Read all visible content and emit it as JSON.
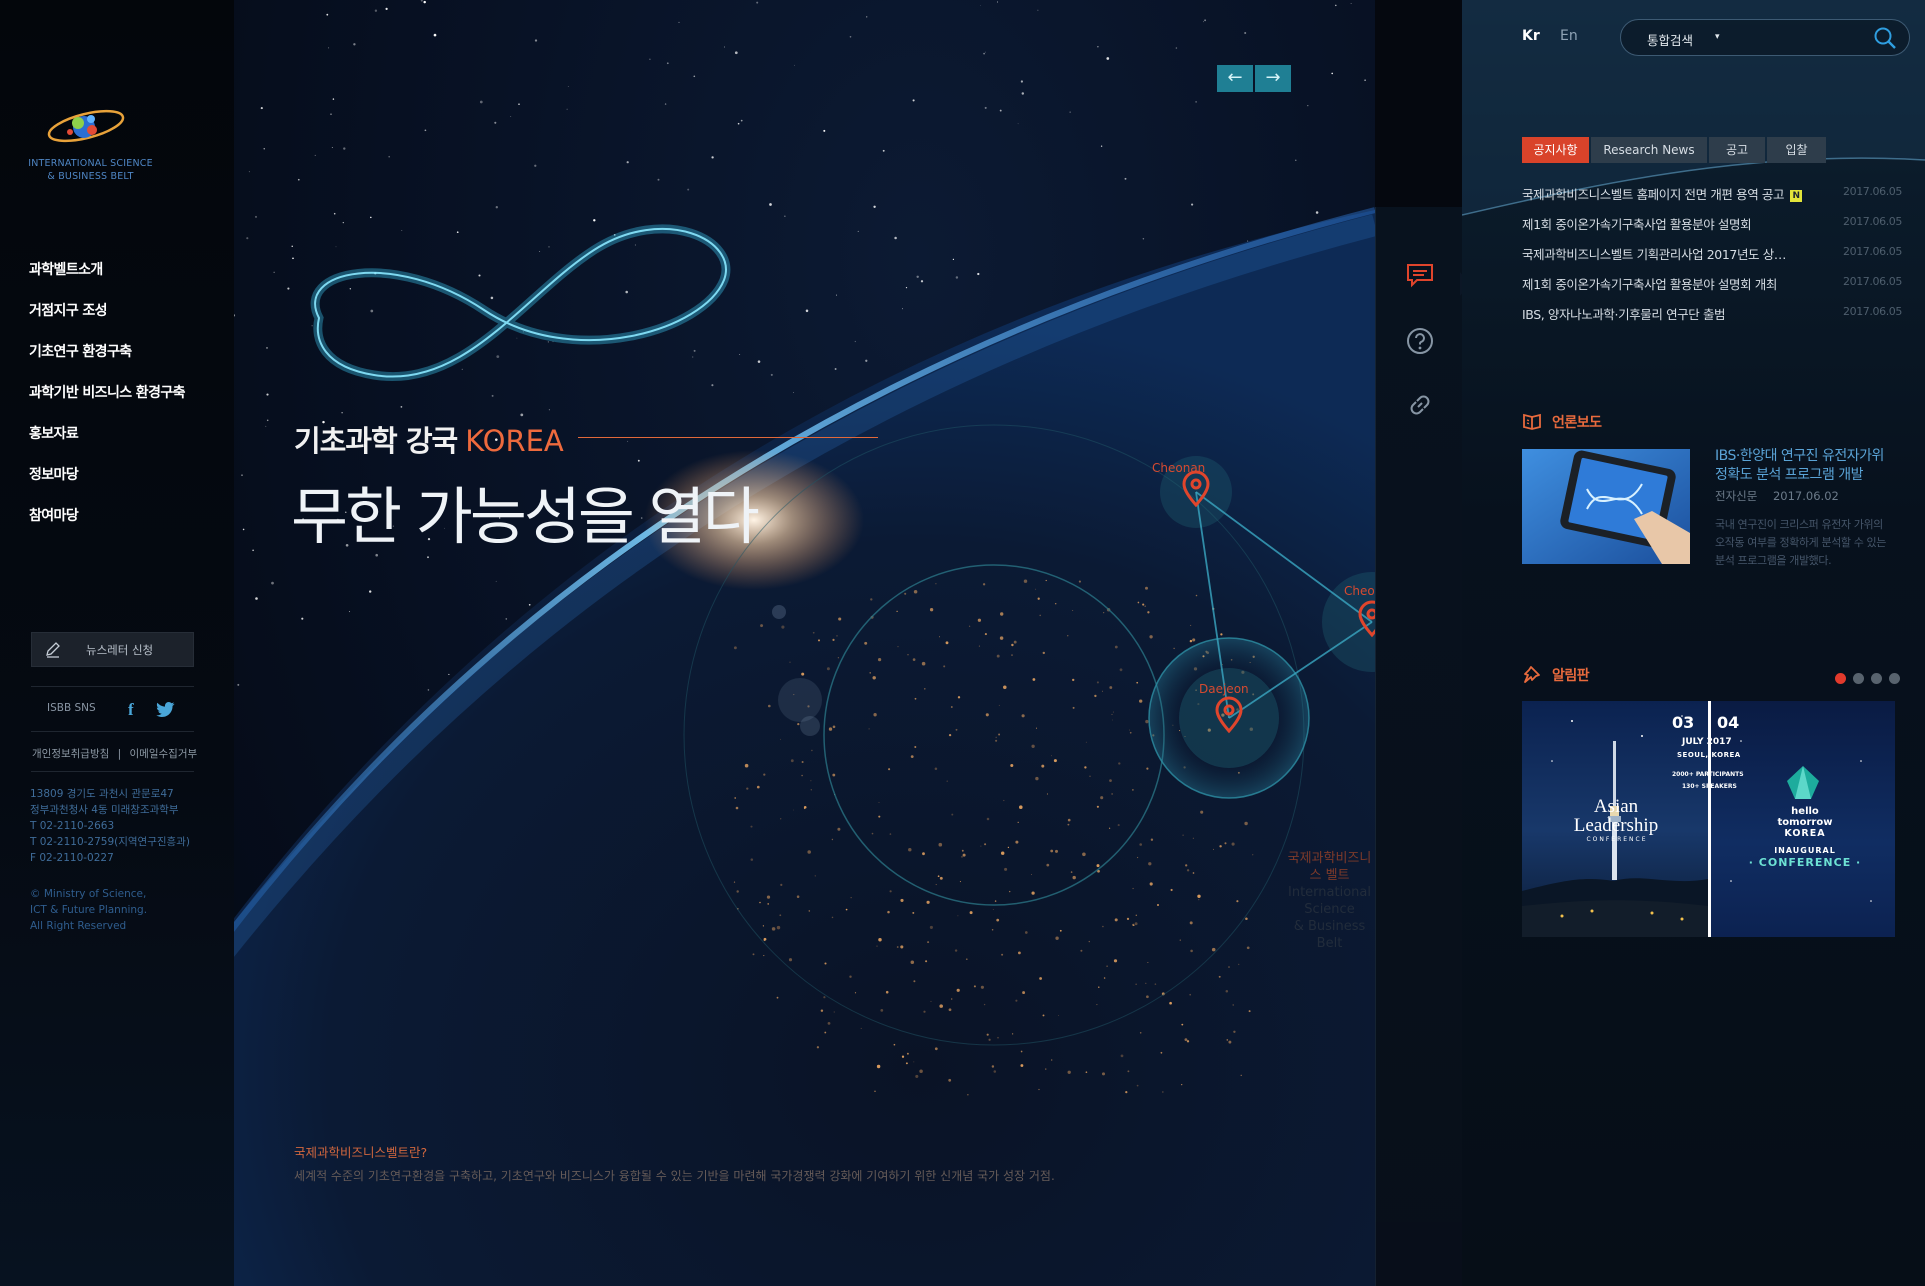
{
  "colors": {
    "accent": "#e86a3d",
    "active_tab": "#d9432a",
    "link_blue": "#5aa3d6",
    "arrow_button": "#1f7f94"
  },
  "logo": {
    "line1": "INTERNATIONAL SCIENCE",
    "line2": "& BUSINESS BELT"
  },
  "sidebar": {
    "nav": [
      "과학벨트소개",
      "거점지구 조성",
      "기초연구 환경구축",
      "과학기반 비즈니스 환경구축",
      "홍보자료",
      "정보마당",
      "참여마당"
    ],
    "newsletter_label": "뉴스레터 신청",
    "sns_label": "ISBB SNS",
    "facebook_glyph": "f",
    "policy_links": [
      "개인정보취급방침",
      "|",
      "이메일수집거부"
    ],
    "address": [
      "13809  경기도 과천시 관문로47",
      "정부과천청사 4동 미래창조과학부"
    ],
    "phone_lines": [
      "T  02-2110-2663",
      "T  02-2110-2759(지역연구진흥과)",
      "F  02-2110-0227"
    ],
    "copyright": [
      "© Ministry of Science,",
      "ICT & Future Planning.",
      "All Right Reserved"
    ]
  },
  "hero": {
    "slide_prev": "←",
    "slide_next": "→",
    "subtitle": "기초과학 강국",
    "subtitle_en": "KOREA",
    "title": "무한 가능성을 열다",
    "isbb_question": "국제과학비즈니스벨트란?",
    "isbb_desc": "세계적 수준의 기초연구환경을 구축하고, 기초연구와 비즈니스가 융합될 수 있는 기반을 마련해 국가경쟁력 강화에 기여하기 위한 신개념 국가 성장 거점.",
    "cities": {
      "cheonan": "Cheonan",
      "cheongju": "Cheongju",
      "daejeon": "Daejeon"
    },
    "map_label_ko": "국제과학비즈니스 벨트",
    "map_label_en_1": "International Science",
    "map_label_en_2": "& Business Belt"
  },
  "tools": [
    "chat-icon",
    "help-icon",
    "link-icon"
  ],
  "header": {
    "lang_kr": "Kr",
    "lang_en": "En",
    "search_scope": "통합검색",
    "search_caret": "▾",
    "search_placeholder": ""
  },
  "notices": {
    "tabs": [
      "공지사항",
      "Research News",
      "공고",
      "입찰"
    ],
    "active_tab": 0,
    "new_badge": "N",
    "items": [
      {
        "title": "국제과학비즈니스벨트 홈페이지 전면 개편 용역 공고",
        "date": "2017.06.05",
        "is_new": true
      },
      {
        "title": "제1회 중이온가속기구축사업 활용분야 설명회",
        "date": "2017.06.05",
        "is_new": false
      },
      {
        "title": "국제과학비즈니스벨트 기획관리사업 2017년도 상…",
        "date": "2017.06.05",
        "is_new": false
      },
      {
        "title": "제1회 중이온가속기구축사업 활용분야 설명회 개최",
        "date": "2017.06.05",
        "is_new": false
      },
      {
        "title": "IBS, 양자나노과학·기후물리 연구단 출범",
        "date": "2017.06.05",
        "is_new": false
      }
    ]
  },
  "press": {
    "section_title": "언론보도",
    "headline": "IBS·한양대 연구진 유전자가위 정확도 분석 프로그램 개발",
    "source": "전자신문",
    "date": "2017.06.02",
    "body": "국내 연구진이 크리스퍼 유전자 가위의 오작동 여부를 정확하게 분석할 수 있는 분석 프로그램을 개발했다."
  },
  "board": {
    "section_title": "알림판",
    "dots": 4,
    "active_dot": 0,
    "banner": {
      "date1": "03",
      "date2": "04",
      "month": "JULY 2017",
      "city": "SEOUL, KOREA",
      "participants": "2000+ PARTICIPANTS",
      "speakers": "130+ SPEAKERS",
      "asian_leadership": "Asian Leadership",
      "conference": "CONFERENCE",
      "hello": "hello tomorrow",
      "korea": "KOREA",
      "inaugural": "INAUGURAL",
      "conference2": "· CONFERENCE ·"
    }
  }
}
